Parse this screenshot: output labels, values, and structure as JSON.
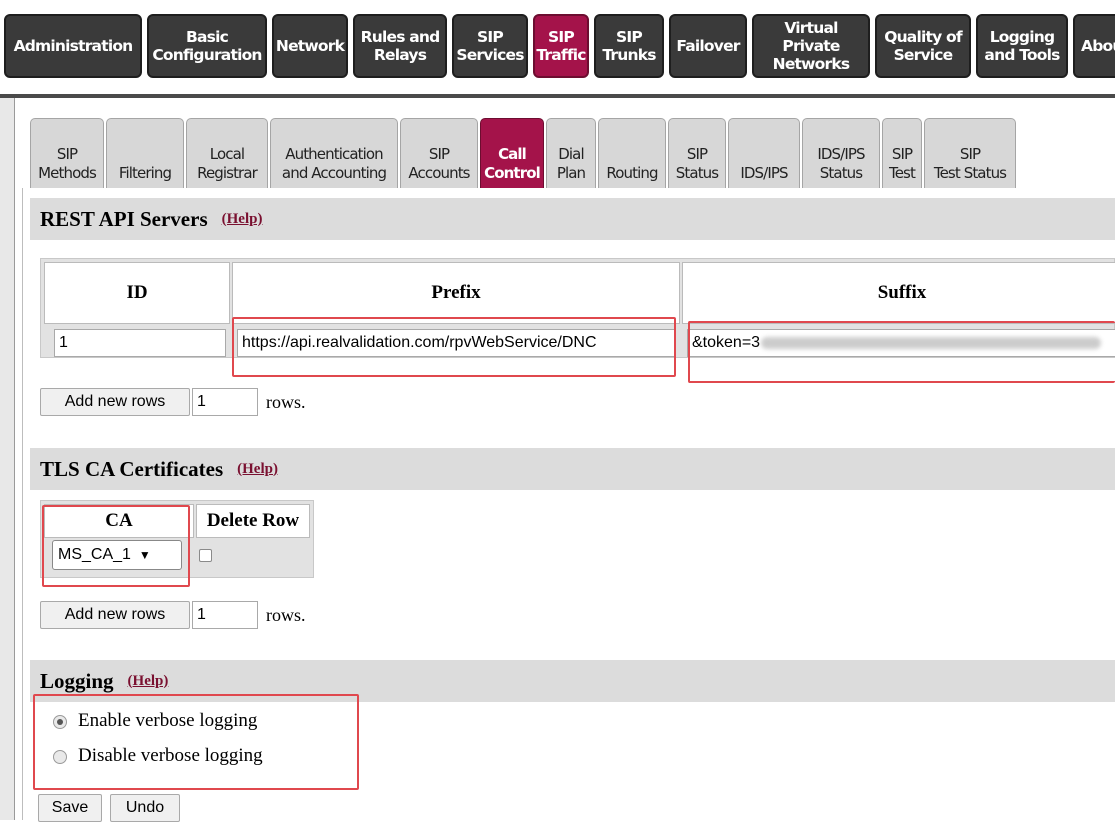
{
  "top_nav": {
    "items": [
      {
        "label": "Administration"
      },
      {
        "label": "Basic\nConfiguration"
      },
      {
        "label": "Network"
      },
      {
        "label": "Rules and\nRelays"
      },
      {
        "label": "SIP\nServices"
      },
      {
        "label": "SIP\nTraffic",
        "active": true
      },
      {
        "label": "SIP\nTrunks"
      },
      {
        "label": "Failover"
      },
      {
        "label": "Virtual Private\nNetworks"
      },
      {
        "label": "Quality of\nService"
      },
      {
        "label": "Logging\nand Tools"
      },
      {
        "label": "About"
      }
    ]
  },
  "sub_tabs": {
    "items": [
      {
        "label": "SIP\nMethods"
      },
      {
        "label": "Filtering"
      },
      {
        "label": "Local\nRegistrar"
      },
      {
        "label": "Authentication\nand Accounting"
      },
      {
        "label": "SIP\nAccounts"
      },
      {
        "label": "Call\nControl",
        "active": true
      },
      {
        "label": "Dial\nPlan"
      },
      {
        "label": "Routing"
      },
      {
        "label": "SIP\nStatus"
      },
      {
        "label": "IDS/IPS"
      },
      {
        "label": "IDS/IPS\nStatus"
      },
      {
        "label": "SIP\nTest"
      },
      {
        "label": "SIP\nTest Status"
      }
    ]
  },
  "rest_api": {
    "title": "REST API Servers",
    "help": "(Help)",
    "columns": [
      "ID",
      "Prefix",
      "Suffix"
    ],
    "row": {
      "id": "1",
      "prefix": "https://api.realvalidation.com/rpvWebService/DNC",
      "suffix": "&token=3"
    },
    "add_rows_button": "Add new rows",
    "add_rows_count": "1",
    "rows_label": "rows."
  },
  "tls_ca": {
    "title": "TLS CA Certificates",
    "help": "(Help)",
    "columns": [
      "CA",
      "Delete Row"
    ],
    "row": {
      "ca": "MS_CA_1",
      "delete": false
    },
    "select_arrow": "▼",
    "add_rows_button": "Add new rows",
    "add_rows_count": "1",
    "rows_label": "rows."
  },
  "logging": {
    "title": "Logging",
    "help": "(Help)",
    "options": [
      {
        "label": "Enable verbose logging",
        "checked": true
      },
      {
        "label": "Disable verbose logging",
        "checked": false
      }
    ]
  },
  "actions": {
    "save": "Save",
    "undo": "Undo"
  },
  "colors": {
    "active_tab": "#a4134a",
    "nav_button": "#3a3a3a",
    "highlight": "#e0484e"
  }
}
